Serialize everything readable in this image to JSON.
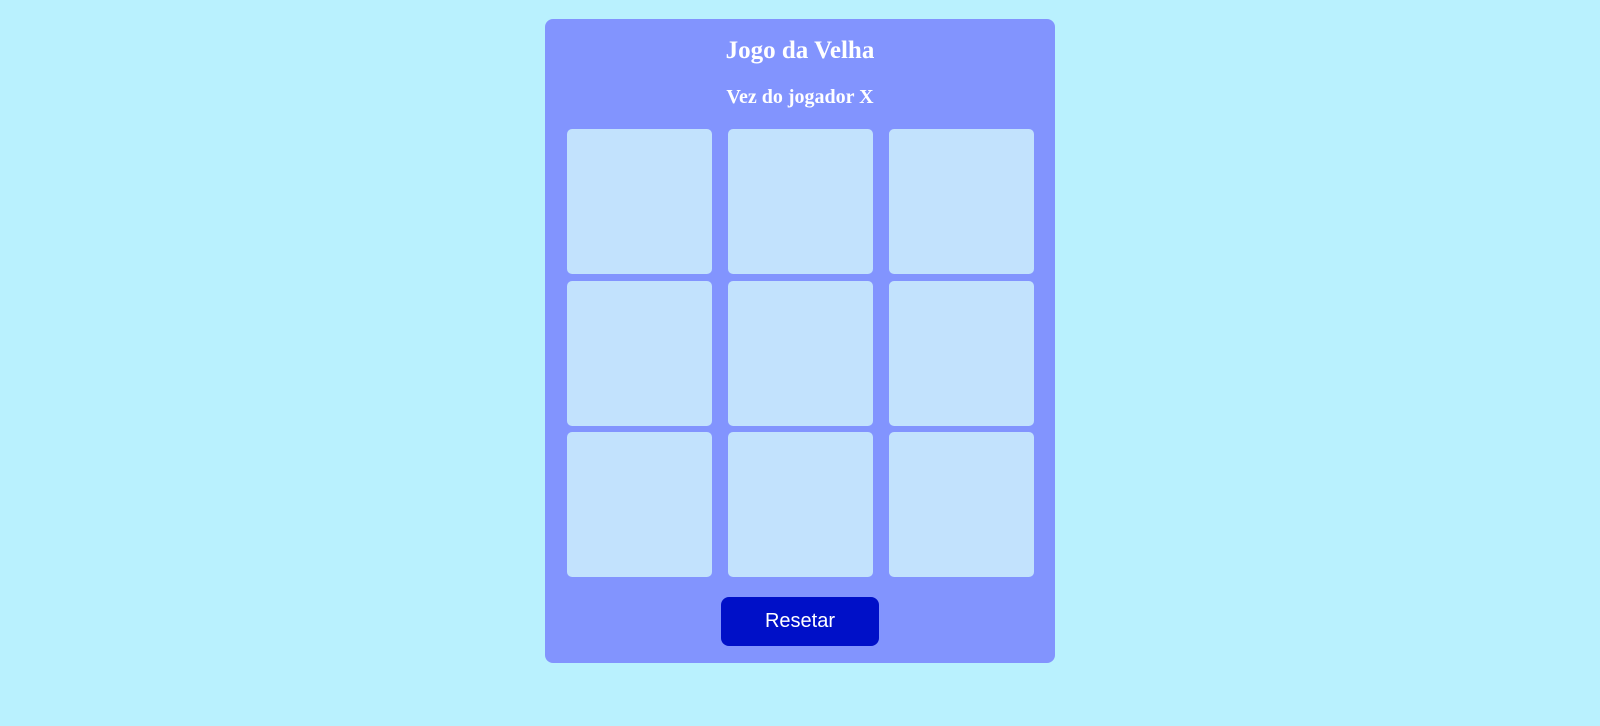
{
  "game": {
    "title": "Jogo da Velha",
    "status": "Vez do jogador X",
    "reset_label": "Resetar"
  },
  "board": {
    "cells": [
      "",
      "",
      "",
      "",
      "",
      "",
      "",
      "",
      ""
    ]
  },
  "colors": {
    "background": "#b9f1fe",
    "panel": "#8294fe",
    "cell": "#c2e2fd",
    "button": "#0010c8",
    "text": "#ffffff"
  }
}
